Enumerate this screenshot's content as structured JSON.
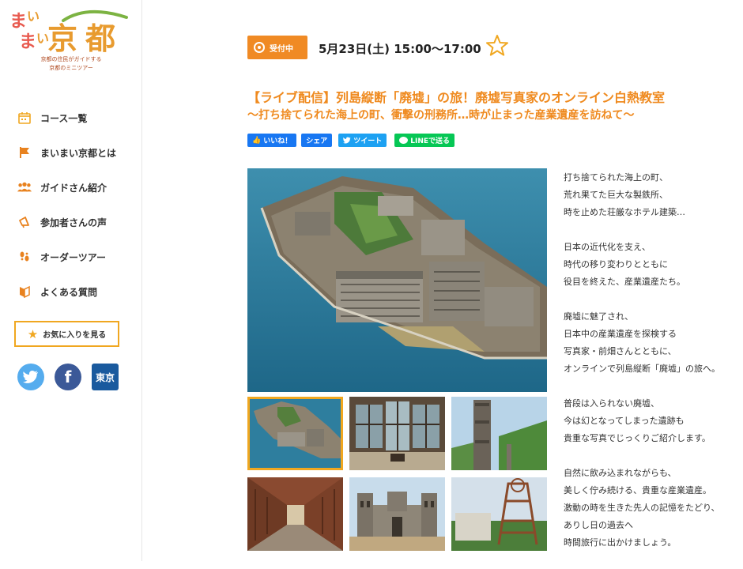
{
  "logo": {
    "text": "まいまい京都",
    "tagline_1": "京都の住民がガイドする",
    "tagline_2": "京都のミニツアー"
  },
  "nav": [
    {
      "label": "コース一覧",
      "icon": "calendar-icon"
    },
    {
      "label": "まいまい京都とは",
      "icon": "flag-icon"
    },
    {
      "label": "ガイドさん紹介",
      "icon": "people-icon"
    },
    {
      "label": "参加者さんの声",
      "icon": "megaphone-icon"
    },
    {
      "label": "オーダーツアー",
      "icon": "footprints-icon"
    },
    {
      "label": "よくある質問",
      "icon": "book-icon"
    }
  ],
  "favorites_button": "お気に入りを見る",
  "social": {
    "twitter_icon": "twitter-icon",
    "facebook_icon": "facebook-icon",
    "tokyo_label": "東京"
  },
  "event": {
    "status": "受付中",
    "date": "5月23日(土) 15:00〜17:00",
    "title": "【ライブ配信】列島縦断「廃墟」の旅！廃墟写真家のオンライン白熱教室",
    "subtitle": "〜打ち捨てられた海上の町、衝撃の刑務所…時が止まった産業遺産を訪ねて〜"
  },
  "share": {
    "like": "いいね！",
    "share": "シェア",
    "tweet": "ツイート",
    "line": "LINEで送る"
  },
  "description": [
    [
      "打ち捨てられた海上の町、",
      "荒れ果てた巨大な製鉄所、",
      "時を止めた荘厳なホテル建築…"
    ],
    [
      "日本の近代化を支え、",
      "時代の移り変わりとともに",
      "役目を終えた、産業遺産たち。"
    ],
    [
      "廃墟に魅了され、",
      "日本中の産業遺産を探検する",
      "写真家・前畑さんとともに、",
      "オンラインで列島縦断「廃墟」の旅へ。"
    ],
    [
      "普段は入られない廃墟、",
      "今は幻となってしまった遺跡も",
      "貴重な写真でじっくりご紹介します。"
    ],
    [
      "自然に飲み込まれながらも、",
      "美しく佇み続ける、貴重な産業遺産。",
      "激動の時を生きた先人の記憶をたどり、",
      "ありし日の過去へ",
      "時間旅行に出かけましょう。"
    ]
  ],
  "colors": {
    "accent": "#ef8a1f",
    "badge": "#f08a24",
    "star": "#f0a720",
    "facebook_blue": "#1877f2",
    "twitter_blue": "#1da1f2",
    "line_green": "#06c755"
  }
}
